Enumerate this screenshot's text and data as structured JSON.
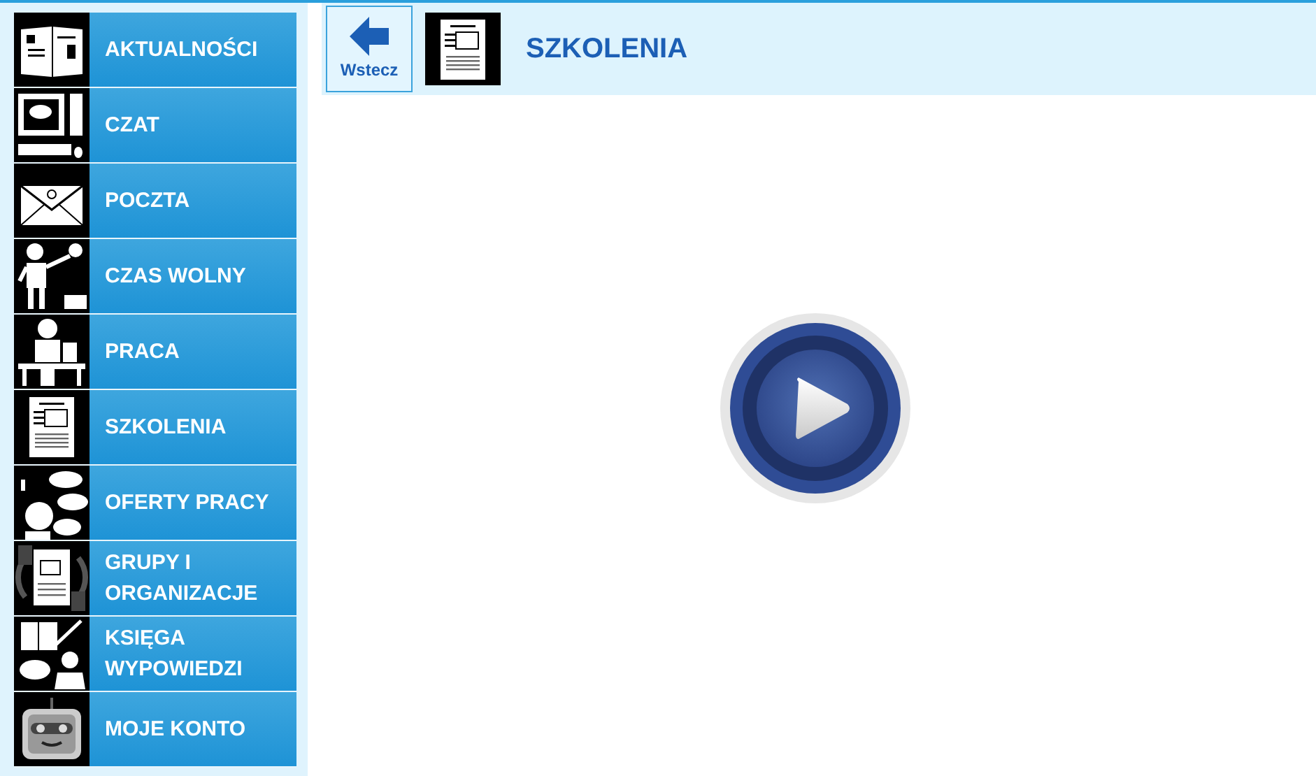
{
  "sidebar": {
    "items": [
      {
        "label": "AKTUALNOŚCI"
      },
      {
        "label": "CZAT"
      },
      {
        "label": "POCZTA"
      },
      {
        "label": "CZAS WOLNY"
      },
      {
        "label": "PRACA"
      },
      {
        "label": "SZKOLENIA"
      },
      {
        "label": "OFERTY PRACY"
      },
      {
        "label": "GRUPY I ORGANIZACJE"
      },
      {
        "label": "KSIĘGA WYPOWIEDZI"
      },
      {
        "label": "MOJE KONTO"
      }
    ]
  },
  "header": {
    "back_button": "Wstecz",
    "title": "SZKOLENIA"
  }
}
